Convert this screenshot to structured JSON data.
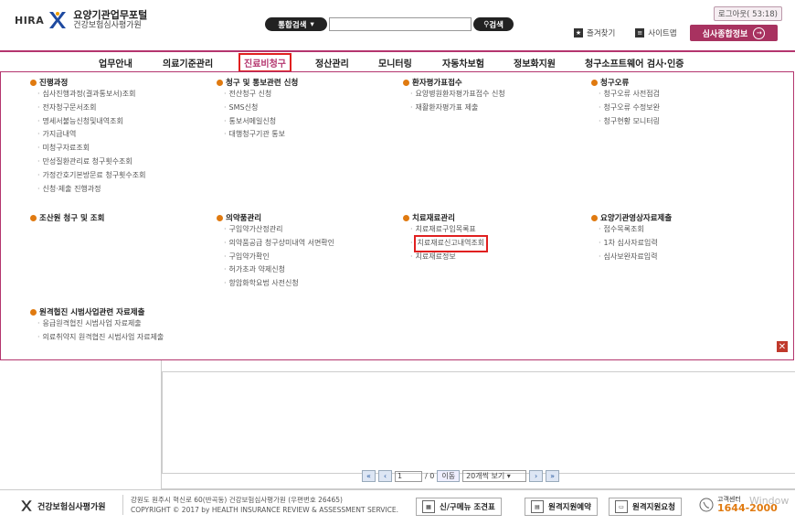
{
  "header": {
    "brand": "HIRA",
    "title": "요양기관업무포털",
    "subtitle": "건강보험심사평가원",
    "search_select": "통합검색",
    "search_button": "검색",
    "logout": "로그아웃( 53:18)",
    "favorites": "즐겨찾기",
    "sitemap": "사이트맵",
    "exam_info": "심사종합정보"
  },
  "gnb": [
    "업무안내",
    "의료기준관리",
    "진료비청구",
    "정산관리",
    "모니터링",
    "자동차보험",
    "정보화지원",
    "청구소프트웨어 검사·인증"
  ],
  "mega": {
    "c1s1": {
      "title": "진행과정",
      "items": [
        "심사진행과정(결과통보서)조회",
        "전자청구문서조회",
        "명세서불능신청및내역조회",
        "가지급내역",
        "미청구자료조회",
        "만성질환관리료 청구횟수조회",
        "가정간호기본방문료 청구횟수조회",
        "신청·제출 진행과정"
      ]
    },
    "c1s2": {
      "title": "조산원 청구 및 조회",
      "items": []
    },
    "c1s3": {
      "title": "원격협진 시범사업관련 자료제출",
      "items": [
        "응급원격협진 시범사업 자료제출",
        "의료취약지 원격협진 시범사업 자료제출"
      ]
    },
    "c2s1": {
      "title": "청구 및 통보관련 신청",
      "items": [
        "전산청구 신청",
        "SMS신청",
        "통보서메일신청",
        "대행청구기관 통보"
      ]
    },
    "c2s2": {
      "title": "의약품관리",
      "items": [
        "구입약가산정관리",
        "의약품공급 청구상미내역 서면확인",
        "구입약가확인",
        "허가초과 약제신청",
        "항암화학요법 사전신청"
      ]
    },
    "c3s1": {
      "title": "환자평가표접수",
      "items": [
        "요양병원환자평가표접수 신청",
        "재활환자평가표 제출"
      ]
    },
    "c3s2": {
      "title": "치료재료관리",
      "items": [
        "치료재료구입목록표",
        "치료재료신고내역조회",
        "치료재료정보"
      ]
    },
    "c4s1": {
      "title": "청구오류",
      "items": [
        "청구오류 사전점검",
        "청구오류 수정보완",
        "청구현황 모니터링"
      ]
    },
    "c4s2": {
      "title": "요양기관영상자료제출",
      "items": [
        "접수목록조회",
        "1차 심사자료입력",
        "심사보완자료입력"
      ]
    }
  },
  "pager": {
    "page": "1",
    "total": "/ 0",
    "go": "이동",
    "size": "20개씩 보기"
  },
  "footer": {
    "org": "건강보험심사평가원",
    "addr": "강원도 원주시 혁신로 60(반곡동) 건강보험심사평가원 (우편번호 26465)",
    "copy": "COPYRIGHT © 2017 by HEALTH INSURANCE REVIEW & ASSESSMENT SERVICE.",
    "b1": "신/구메뉴 조견표",
    "b2": "원격지원예약",
    "b3": "원격지원요청",
    "call_label": "고객센터",
    "call_num": "1644-2000",
    "win": "Window"
  }
}
